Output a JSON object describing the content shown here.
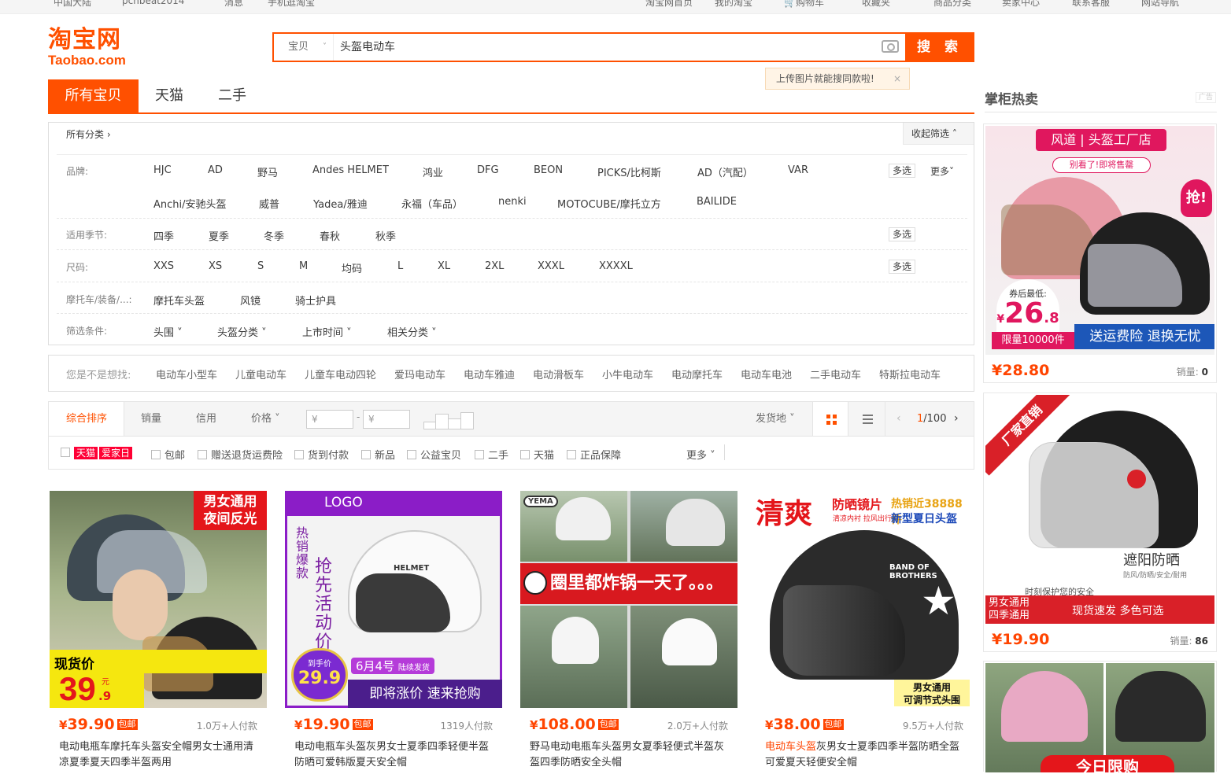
{
  "topbar": {
    "items": [
      "中国大陆",
      "pcnbeat2014",
      "消息",
      "手机逛淘宝",
      "淘宝网首页",
      "我的淘宝",
      "购物车",
      "收藏夹",
      "商品分类",
      "卖家中心",
      "联系客服",
      "网站导航"
    ]
  },
  "logo": {
    "cn": "淘宝网",
    "en": "Taobao.com"
  },
  "search": {
    "category": "宝贝",
    "query": "头盔电动车",
    "button": "搜 索"
  },
  "tip": {
    "text": "上传图片就能搜同款啦!",
    "close": "×"
  },
  "tabs": [
    "所有宝贝",
    "天猫",
    "二手"
  ],
  "filters": {
    "all_categories": "所有分类 ›",
    "collapse": "收起筛选 ˄",
    "brand": {
      "label": "品牌:",
      "values": [
        "HJC",
        "AD",
        "野马",
        "Andes HELMET",
        "鸿业",
        "DFG",
        "BEON",
        "PICKS/比柯斯",
        "AD（汽配）",
        "VAR",
        "Anchi/安驰头盔",
        "威普",
        "Yadea/雅迪",
        "永福（车品）",
        "nenki",
        "MOTOCUBE/摩托立方",
        "BAILIDE"
      ],
      "multi": "多选",
      "more": "更多˅"
    },
    "season": {
      "label": "适用季节:",
      "values": [
        "四季",
        "夏季",
        "冬季",
        "春秋",
        "秋季"
      ],
      "multi": "多选"
    },
    "size": {
      "label": "尺码:",
      "values": [
        "XXS",
        "XS",
        "S",
        "M",
        "均码",
        "L",
        "XL",
        "2XL",
        "XXXL",
        "XXXXL"
      ],
      "multi": "多选"
    },
    "moto": {
      "label": "摩托车/装备/...:",
      "values": [
        "摩托车头盔",
        "风镜",
        "骑士护具"
      ]
    },
    "conditions": {
      "label": "筛选条件:",
      "values": [
        "头围 ˅",
        "头盔分类 ˅",
        "上市时间 ˅",
        "相关分类 ˅"
      ]
    }
  },
  "suggestions": {
    "label": "您是不是想找:",
    "items": [
      "电动车小型车",
      "儿童电动车",
      "儿童车电动四轮",
      "爱玛电动车",
      "电动车雅迪",
      "电动滑板车",
      "小牛电动车",
      "电动摩托车",
      "电动车电池",
      "二手电动车",
      "特斯拉电动车"
    ]
  },
  "sort": {
    "options": [
      "综合排序",
      "销量",
      "信用",
      "价格 ˅"
    ],
    "price_from": "¥",
    "price_to": "¥",
    "dash": "-",
    "ship_from": "发货地 ˅",
    "page": {
      "current": "1",
      "total": "/100"
    }
  },
  "options": {
    "tmall": "天猫",
    "aijia": "爱家日",
    "items": [
      "包邮",
      "赠送退货运费险",
      "货到付款",
      "新品",
      "公益宝贝",
      "二手",
      "天猫",
      "正品保障"
    ],
    "more": "更多 ˅"
  },
  "products": [
    {
      "price": "39.90",
      "currency": "¥",
      "pkg": "包邮",
      "buyers": "1.0万+人付款",
      "title": "电动电瓶车摩托车头盔安全帽男女士通用清凉夏季夏天四季半盔两用",
      "img": {
        "tag1": "男女通用",
        "tag2": "夜间反光",
        "promo": "现货价",
        "big": "39",
        "dec": ".9",
        "yuan": "元"
      }
    },
    {
      "price": "19.90",
      "currency": "¥",
      "pkg": "包邮",
      "buyers": "1319人付款",
      "title": "电动电瓶车头盔灰男女士夏季四季轻便半盔防晒可爱韩版夏天安全帽",
      "img": {
        "logo": "LOGO",
        "v1": "热销爆款",
        "v2": "抢先活动价",
        "badge1": "到手价",
        "badge2": "29.9",
        "date": "6月4号",
        "date2": "陆续发货",
        "bottom": "即将涨价 速来抢购",
        "brand": "HELMET"
      }
    },
    {
      "price": "108.00",
      "currency": "¥",
      "pkg": "包邮",
      "buyers": "2.0万+人付款",
      "title": "野马电动电瓶车头盔男女夏季轻便式半盔灰盔四季防晒安全头帽",
      "img": {
        "logo": "YEMA",
        "banner": "圈里都炸锅一天了。。。"
      }
    },
    {
      "price": "38.00",
      "currency": "¥",
      "pkg": "包邮",
      "buyers": "9.5万+人付款",
      "title_pre": "电动",
      "title_h1": "车头盔",
      "title_post": "灰男女士夏季四季半盔防晒全盔可爱夏天轻便安全帽",
      "title": "",
      "img": {
        "big": "清爽",
        "t1": "防晒镜片",
        "t2": "热销近38888件",
        "t3": "清凉内衬 拉风出行",
        "t4": "新型夏日头盔",
        "br": "男女通用",
        "br2": "可调节式头围",
        "brand": "BAND OF BROTHERS"
      }
    }
  ],
  "sidebar": {
    "title": "掌柜热卖",
    "ad": "广告",
    "items": [
      {
        "price": "¥28.80",
        "sales_label": "销量: ",
        "sales": "0",
        "img": {
          "t1": "风道",
          "t2": "头盔工厂店",
          "t3": "别看了!即将售罄",
          "grab": "抢!",
          "low": "券后最低:",
          "p": "26",
          "pd": ".8",
          "limit": "限量10000件",
          "b": "送运费险 退换无忧"
        }
      },
      {
        "price": "¥19.90",
        "sales_label": "销量: ",
        "sales": "86",
        "img": {
          "corner": "厂家直销",
          "t1": "遮阳防晒",
          "t2": "防风/防晒/安全/耐用",
          "t3": "时刻保护您的安全",
          "l1": "男女通用",
          "l2": "四季通用",
          "b": "现货速发 多色可选"
        }
      },
      {
        "img": {
          "b": "今日限购"
        }
      }
    ]
  },
  "colors": {
    "accent": "#ff5000",
    "price": "#ff4400",
    "tmall": "#ff0036"
  }
}
